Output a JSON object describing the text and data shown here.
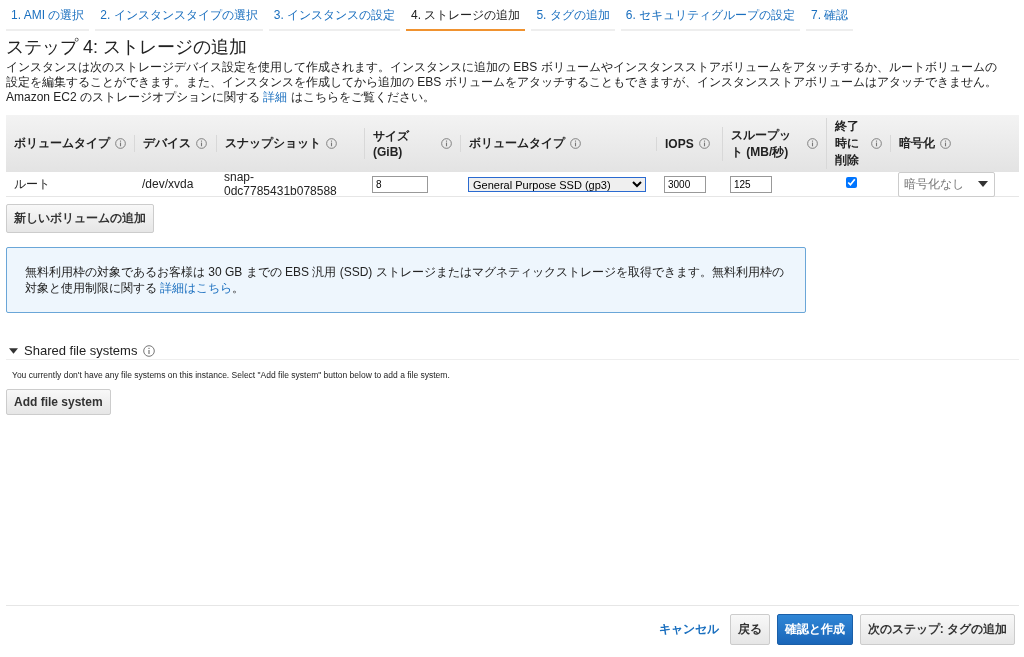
{
  "steps": [
    {
      "label": "1. AMI の選択",
      "selected": false
    },
    {
      "label": "2. インスタンスタイプの選択",
      "selected": false
    },
    {
      "label": "3. インスタンスの設定",
      "selected": false
    },
    {
      "label": "4. ストレージの追加",
      "selected": true
    },
    {
      "label": "5. タグの追加",
      "selected": false
    },
    {
      "label": "6. セキュリティグループの設定",
      "selected": false
    },
    {
      "label": "7. 確認",
      "selected": false
    }
  ],
  "title": "ステップ 4: ストレージの追加",
  "description": {
    "before": "インスタンスは次のストレージデバイス設定を使用して作成されます。インスタンスに追加の EBS ボリュームやインスタンスストアボリュームをアタッチするか、ルートボリュームの設定を編集することができます。また、インスタンスを作成してから追加の EBS ボリュームをアタッチすることもできますが、インスタンスストアボリュームはアタッチできません。Amazon EC2 のストレージオプションに関する ",
    "link": "詳細",
    "after": " はこちらをご覧ください。"
  },
  "table": {
    "columns": [
      "ボリュームタイプ",
      "デバイス",
      "スナップショット",
      "サイズ (GiB)",
      "ボリュームタイプ",
      "IOPS",
      "スループット (MB/秒)",
      "終了時に削除",
      "暗号化"
    ],
    "rows": [
      {
        "cells": [
          {
            "kind": "text",
            "value": "ルート"
          },
          {
            "kind": "text",
            "value": "/dev/xvda"
          },
          {
            "kind": "text",
            "value": "snap-0dc7785431b078588"
          },
          {
            "kind": "input",
            "value": "8"
          },
          {
            "kind": "select",
            "value": "General Purpose SSD (gp3)"
          },
          {
            "kind": "input",
            "value": "3000"
          },
          {
            "kind": "input",
            "value": "125"
          },
          {
            "kind": "checkbox",
            "checked": true
          },
          {
            "kind": "dropdown",
            "placeholder": "暗号化なし"
          }
        ]
      }
    ]
  },
  "add_volume_button": "新しいボリュームの追加",
  "info": {
    "before": "無料利用枠の対象であるお客様は 30 GB までの EBS 汎用 (SSD) ストレージまたはマグネティックストレージを取得できます。無料利用枠の対象と使用制限に関する ",
    "link": "詳細はこちら",
    "after": "。"
  },
  "shared": {
    "title": "Shared file systems",
    "expanded": true,
    "message": "You currently don't have any file systems on this instance. Select \"Add file system\" button below to add a file system.",
    "button": "Add file system"
  },
  "footer": {
    "cancel": "キャンセル",
    "back": "戻る",
    "review": "確認と作成",
    "next": "次のステップ: タグの追加"
  }
}
